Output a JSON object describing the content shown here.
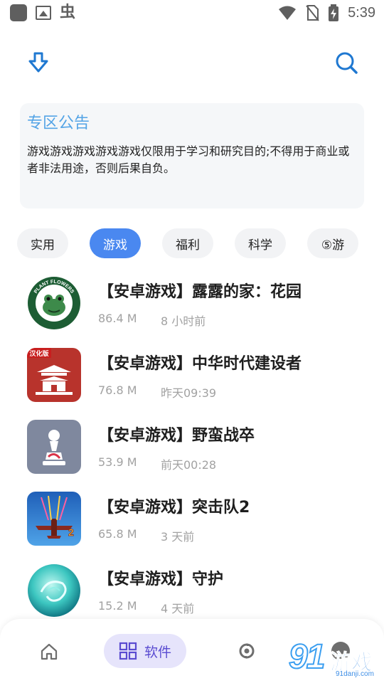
{
  "status_bar": {
    "time": "5:39",
    "bug_glyph": "虫",
    "icons": [
      "app-square-icon",
      "gallery-icon",
      "bug-icon",
      "wifi-icon",
      "no-sim-icon",
      "battery-charging-icon"
    ]
  },
  "toolbar": {
    "download_icon": "download-icon",
    "search_icon": "search-icon"
  },
  "notice": {
    "title": "专区公告",
    "body": "游戏游戏游戏游戏游戏仅限用于学习和研究目的;不得用于商业或者非法用途，否则后果自负。"
  },
  "categories": [
    {
      "label": "实用",
      "active": false
    },
    {
      "label": "游戏",
      "active": true
    },
    {
      "label": "福利",
      "active": false
    },
    {
      "label": "科学",
      "active": false
    },
    {
      "label": "⑤游",
      "active": false
    }
  ],
  "apps": [
    {
      "name": "【安卓游戏】露露的家：花园",
      "size": "86.4 M",
      "time": "8 小时前",
      "icon": "plant-flowers-icon",
      "icon_text_top": "PLANT FLOWERS",
      "icon_text_bottom": "LOVE THE GREEN HOUSE"
    },
    {
      "name": "【安卓游戏】中华时代建设者",
      "size": "76.8 M",
      "time": "昨天09:39",
      "icon": "palace-icon",
      "icon_badge": "汉化版"
    },
    {
      "name": "【安卓游戏】野蛮战卒",
      "size": "53.9 M",
      "time": "前天00:28",
      "icon": "chess-pawn-icon"
    },
    {
      "name": "【安卓游戏】突击队2",
      "size": "65.8 M",
      "time": "3 天前",
      "icon": "fighter-plane-icon",
      "icon_number": "2"
    },
    {
      "name": "【安卓游戏】守护",
      "size": "15.2 M",
      "time": "4 天前",
      "icon": "teal-orb-icon"
    }
  ],
  "bottom_nav": {
    "items": [
      {
        "name": "home",
        "icon": "home-icon"
      },
      {
        "name": "software",
        "label": "软件",
        "icon": "grid-icon",
        "active": true
      },
      {
        "name": "discover",
        "icon": "discover-icon"
      },
      {
        "name": "me",
        "icon": "profile-icon"
      }
    ]
  },
  "watermark": {
    "number": "91",
    "text": "游戏",
    "url": "91danji.com"
  },
  "colors": {
    "accent": "#4a88f0",
    "icon_blue": "#1f78d1",
    "notice_title": "#54a4e6",
    "nav_active_bg": "#e6e4fb",
    "nav_active_fg": "#5a4bd1",
    "muted_text": "#a2a2a2"
  }
}
